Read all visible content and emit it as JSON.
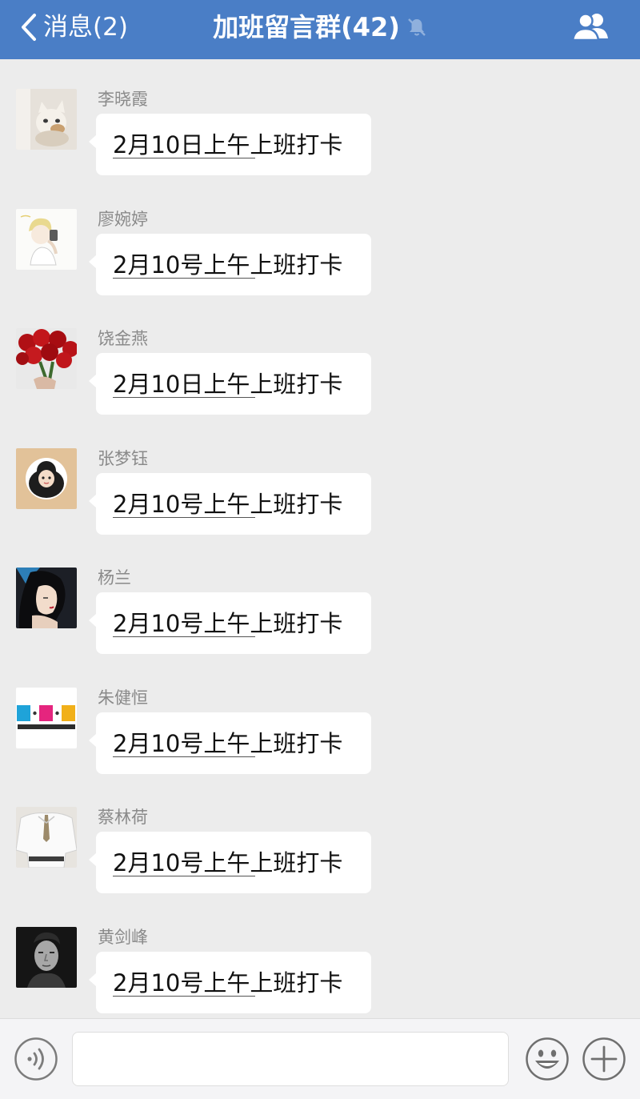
{
  "header": {
    "back_label": "消息(2)",
    "title": "加班留言群(42)",
    "background": "#4a7ec6",
    "icons": {
      "back": "chevron-left-icon",
      "mute": "bell-off-icon",
      "members": "group-members-icon"
    }
  },
  "messages": [
    {
      "sender": "李晓霞",
      "text": "2月10日上午上班打卡",
      "avatar": "cat-photo"
    },
    {
      "sender": "廖婉婷",
      "text": "2月10号上午上班打卡",
      "avatar": "anime-boy-drawing"
    },
    {
      "sender": "饶金燕",
      "text": "2月10日上午上班打卡",
      "avatar": "red-roses"
    },
    {
      "sender": "张梦钰",
      "text": "2月10号上午上班打卡",
      "avatar": "cartoon-girl"
    },
    {
      "sender": "杨兰",
      "text": "2月10号上午上班打卡",
      "avatar": "illustrated-woman"
    },
    {
      "sender": "朱健恒",
      "text": "2月10号上午上班打卡",
      "avatar": "bsl-design-logo"
    },
    {
      "sender": "蔡林荷",
      "text": "2月10号上午上班打卡",
      "avatar": "white-shirt"
    },
    {
      "sender": "黄剑峰",
      "text": "2月10号上午上班打卡",
      "avatar": "man-portrait"
    }
  ],
  "input_bar": {
    "text_value": "",
    "icons": {
      "voice": "voice-icon",
      "emoji": "emoji-icon",
      "plus": "plus-icon"
    }
  }
}
